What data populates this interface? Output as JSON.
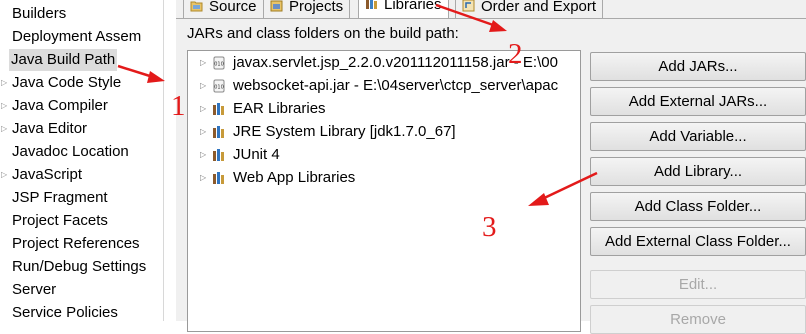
{
  "sidebar": {
    "items": [
      {
        "label": "Builders",
        "expandable": false
      },
      {
        "label": "Deployment Assem",
        "expandable": false
      },
      {
        "label": "Java Build Path",
        "expandable": false,
        "selected": true
      },
      {
        "label": "Java Code Style",
        "expandable": true
      },
      {
        "label": "Java Compiler",
        "expandable": true
      },
      {
        "label": "Java Editor",
        "expandable": true
      },
      {
        "label": "Javadoc Location",
        "expandable": false
      },
      {
        "label": "JavaScript",
        "expandable": true
      },
      {
        "label": "JSP Fragment",
        "expandable": false
      },
      {
        "label": "Project Facets",
        "expandable": false
      },
      {
        "label": "Project References",
        "expandable": false
      },
      {
        "label": "Run/Debug Settings",
        "expandable": false
      },
      {
        "label": "Server",
        "expandable": false
      },
      {
        "label": "Service Policies",
        "expandable": false
      }
    ]
  },
  "tabs": [
    {
      "label": "Source",
      "icon": "source-folder-icon",
      "active": false
    },
    {
      "label": "Projects",
      "icon": "projects-icon",
      "active": false
    },
    {
      "label": "Libraries",
      "icon": "libraries-icon",
      "active": true
    },
    {
      "label": "Order and Export",
      "icon": "order-export-icon",
      "active": false
    }
  ],
  "main": {
    "heading": "JARs and class folders on the build path:",
    "tree": [
      {
        "label": "javax.servlet.jsp_2.2.0.v201112011158.jar - E:\\00",
        "icon": "jar-icon"
      },
      {
        "label": "websocket-api.jar - E:\\04server\\ctcp_server\\apac",
        "icon": "jar-icon"
      },
      {
        "label": "EAR Libraries",
        "icon": "library-icon"
      },
      {
        "label": "JRE System Library [jdk1.7.0_67]",
        "icon": "library-icon"
      },
      {
        "label": "JUnit 4",
        "icon": "library-icon"
      },
      {
        "label": "Web App Libraries",
        "icon": "library-icon"
      }
    ],
    "buttons": {
      "add_jars": "Add JARs...",
      "add_external_jars": "Add External JARs...",
      "add_variable": "Add Variable...",
      "add_library": "Add Library...",
      "add_class_folder": "Add Class Folder...",
      "add_external_class_folder": "Add External Class Folder...",
      "edit": "Edit...",
      "remove": "Remove"
    }
  },
  "annotations": {
    "color": "#e31a1a",
    "labels": [
      "1",
      "2",
      "3"
    ]
  },
  "colors": {
    "selection": "#dcdcdc",
    "panel_bg": "#f0f0f0",
    "annotation_red": "#e31a1a"
  }
}
